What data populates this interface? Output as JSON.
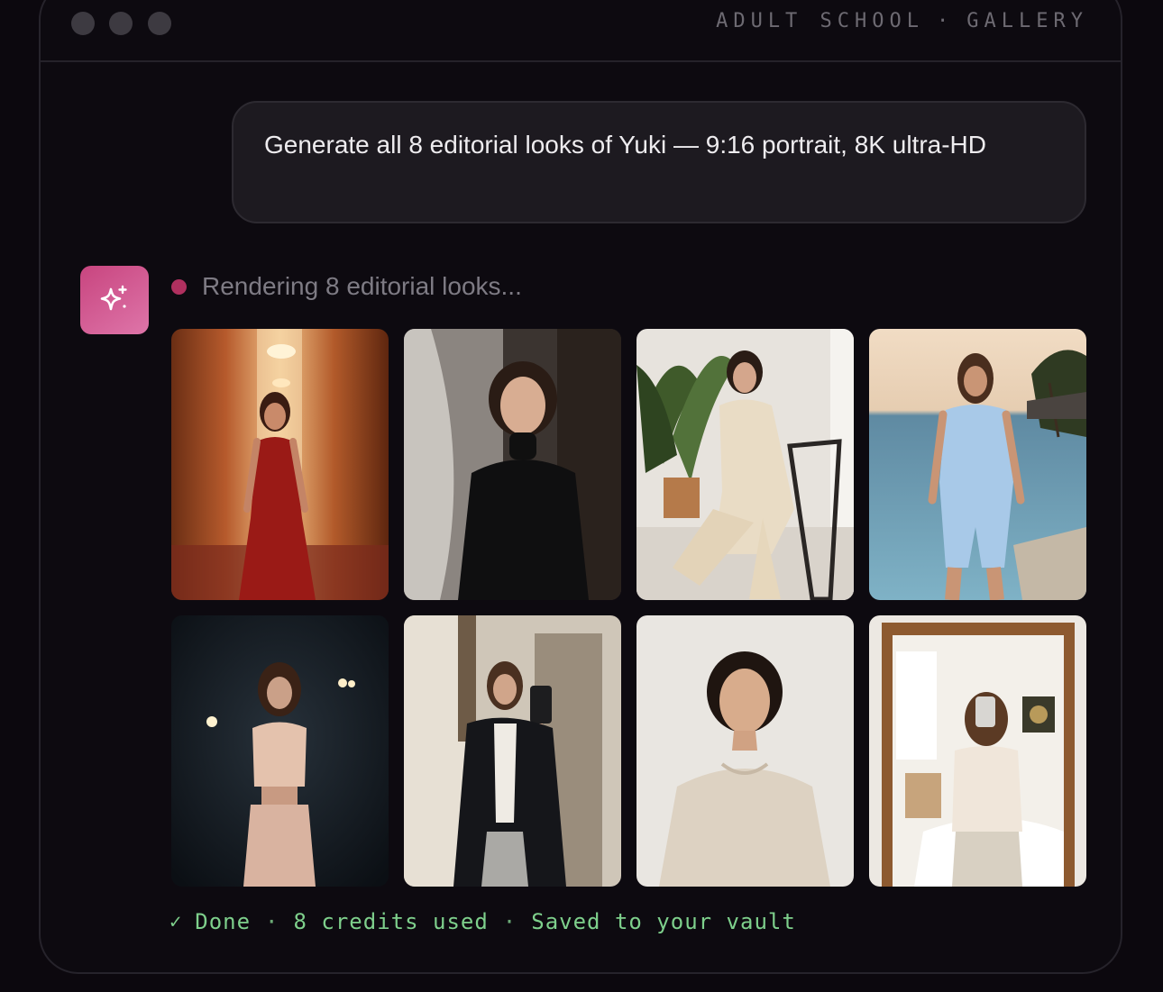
{
  "window": {
    "controls": [
      "close-dot",
      "minimize-dot",
      "maximize-dot"
    ],
    "title_left": "ADULT SCHOOL",
    "title_separator": "·",
    "title_right": "GALLERY"
  },
  "prompt": {
    "text": "Generate all 8 editorial looks of Yuki — 9:16 portrait, 8K ultra-HD"
  },
  "assistant": {
    "icon": "sparkles-icon",
    "status_text": "Rendering 8 editorial looks..."
  },
  "gallery": {
    "images": [
      {
        "id": "look-1",
        "scene": "red-dress-corridor"
      },
      {
        "id": "look-2",
        "scene": "black-turtleneck"
      },
      {
        "id": "look-3",
        "scene": "cream-trench-chair"
      },
      {
        "id": "look-4",
        "scene": "blue-romper-pool"
      },
      {
        "id": "look-5",
        "scene": "blush-outfit-dark-room"
      },
      {
        "id": "look-6",
        "scene": "blazer-mirror-selfie"
      },
      {
        "id": "look-7",
        "scene": "knit-sweater-studio"
      },
      {
        "id": "look-8",
        "scene": "mirror-selfie-bedroom"
      }
    ]
  },
  "footer": {
    "check_icon": "check-icon",
    "done": "Done",
    "credits": "8 credits used",
    "saved": "Saved to your vault",
    "separator": "·",
    "color": "#7ed08c"
  },
  "colors": {
    "accent": "#c8457f",
    "background": "#0c080e",
    "bubble": "#1d1a20"
  }
}
